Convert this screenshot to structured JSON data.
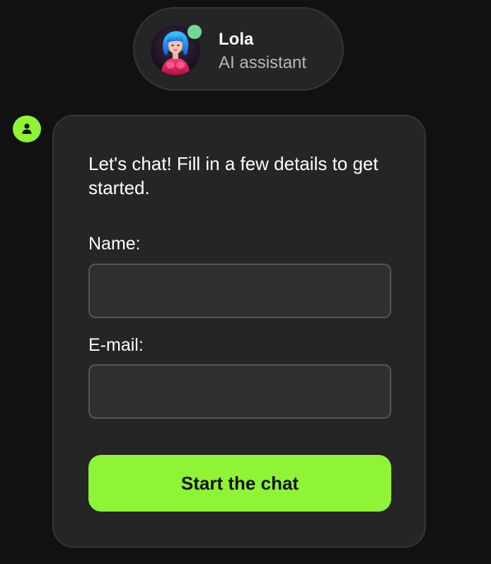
{
  "agent": {
    "name": "Lola",
    "role": "AI assistant",
    "status_color": "#6fd992",
    "avatar_icon": "avatar-portrait"
  },
  "user_marker": {
    "icon": "user-icon",
    "color": "#8ff435"
  },
  "form": {
    "intro": "Let's chat! Fill in a few details to get started.",
    "name_label": "Name:",
    "name_value": "",
    "name_placeholder": "",
    "email_label": "E-mail:",
    "email_value": "",
    "email_placeholder": "",
    "submit_label": "Start the chat",
    "accent_color": "#8ff435"
  }
}
